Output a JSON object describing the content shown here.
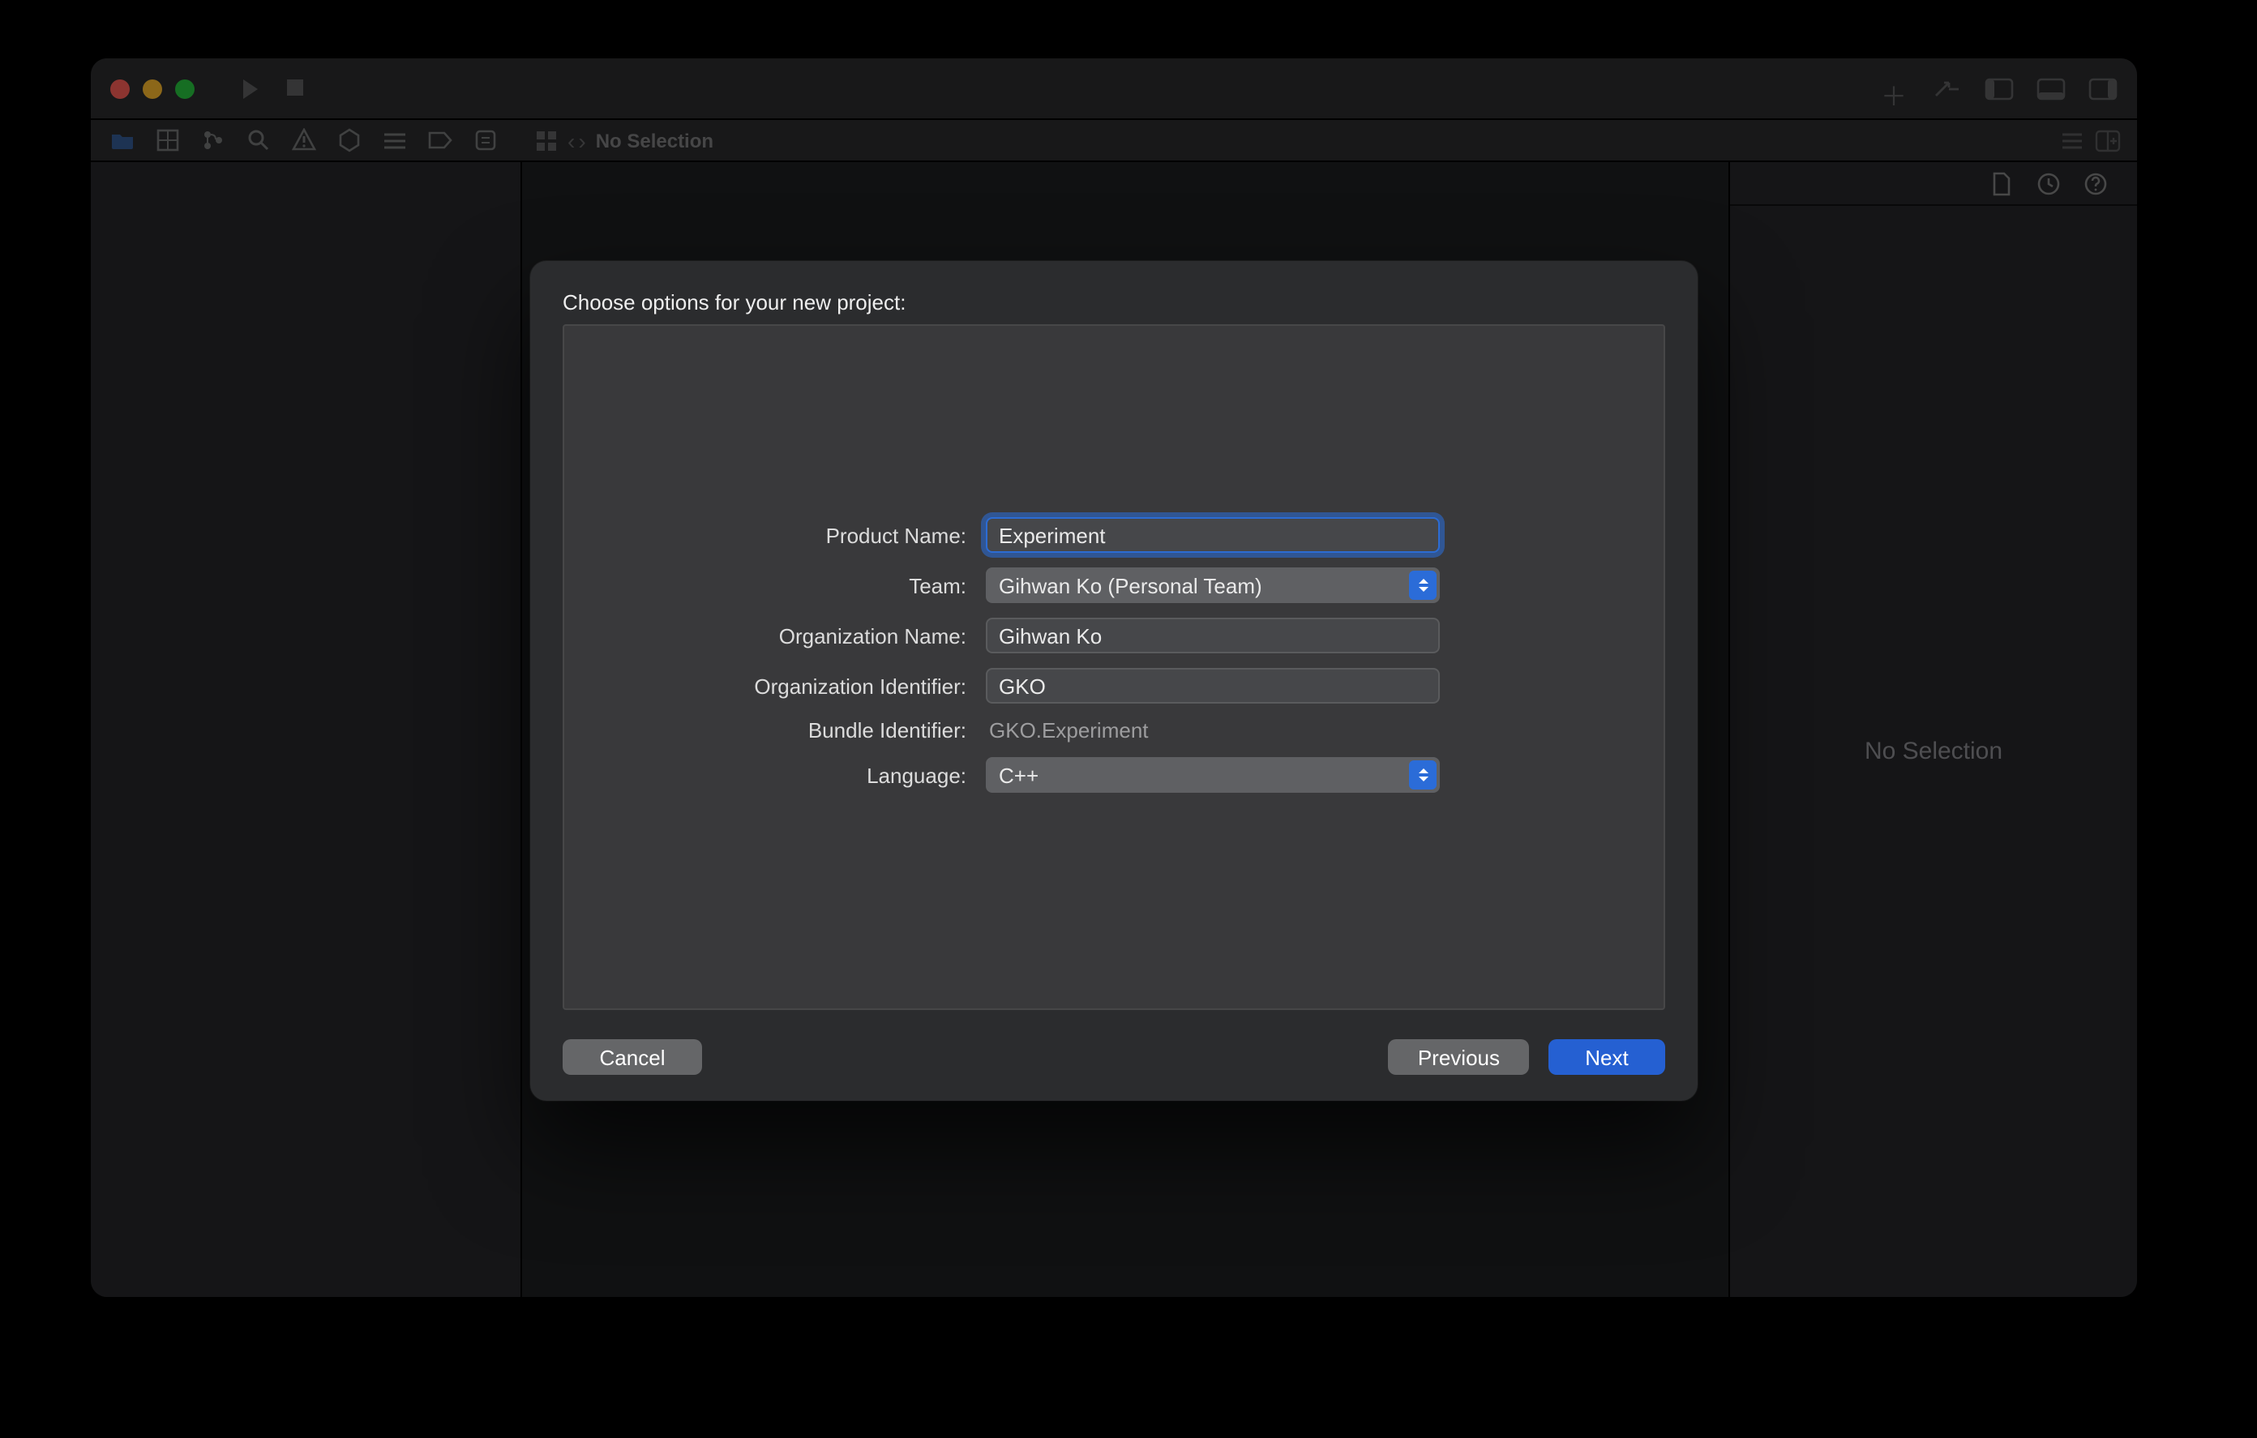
{
  "jumpbar": {
    "title": "No Selection"
  },
  "inspector": {
    "empty_text": "No Selection"
  },
  "sheet": {
    "title": "Choose options for your new project:",
    "labels": {
      "product_name": "Product Name:",
      "team": "Team:",
      "org_name": "Organization Name:",
      "org_id": "Organization Identifier:",
      "bundle_id": "Bundle Identifier:",
      "language": "Language:"
    },
    "values": {
      "product_name": "Experiment",
      "team": "Gihwan Ko (Personal Team)",
      "org_name": "Gihwan Ko",
      "org_id": "GKO",
      "bundle_id": "GKO.Experiment",
      "language": "C++"
    },
    "buttons": {
      "cancel": "Cancel",
      "previous": "Previous",
      "next": "Next"
    }
  }
}
